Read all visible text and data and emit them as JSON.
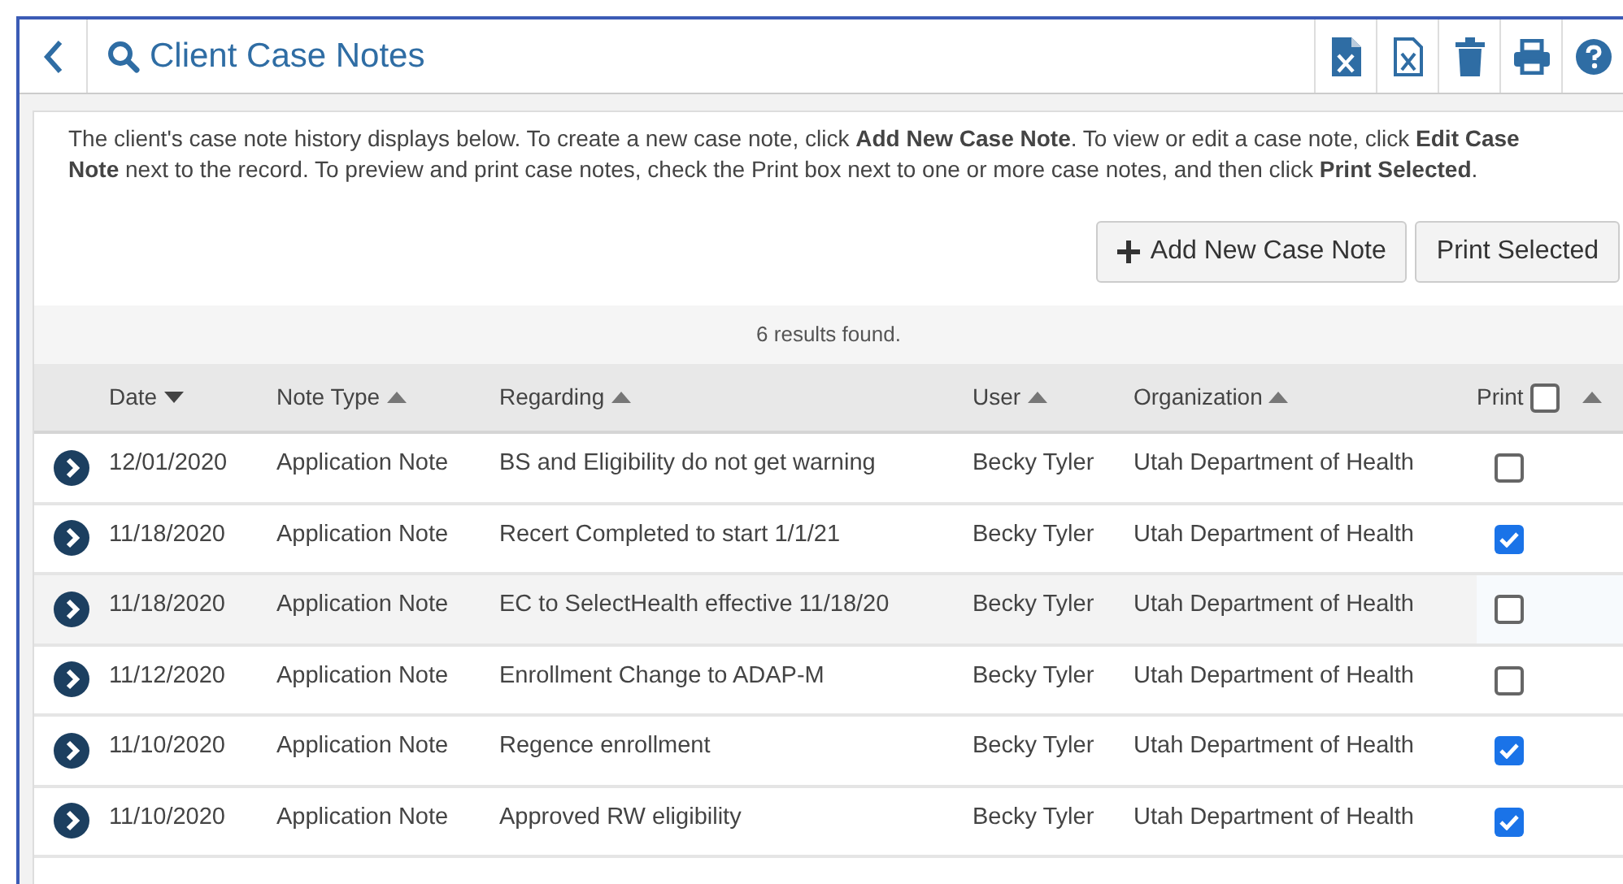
{
  "header": {
    "title": "Client Case Notes"
  },
  "toolbar": [
    {
      "kind": "excel"
    },
    {
      "kind": "excel-outline"
    },
    {
      "kind": "trash"
    },
    {
      "kind": "print"
    },
    {
      "kind": "help"
    }
  ],
  "description": "The client's case note history displays below. To create a new case note, click **Add New Case Note**. To view or edit a case note, click **Edit Case Note** next to the record.  To preview and print case notes, check the Print box next to one or more case notes, and then click **Print Selected**.",
  "buttons": [
    {
      "kind": "add",
      "label": "Add New Case Note"
    },
    {
      "kind": "plain",
      "label": "Print Selected"
    }
  ],
  "results": "6 results found.",
  "table": {
    "columns": [
      {
        "label": "Date",
        "sort_descending": true
      },
      {
        "label": "Note Type",
        "sort_descending": false
      },
      {
        "label": "Regarding",
        "sort_descending": false
      },
      {
        "label": "User",
        "sort_descending": false
      },
      {
        "label": "Organization",
        "sort_descending": false
      },
      {
        "label": "Print",
        "sort_descending": false,
        "select_all": false
      }
    ],
    "rows": [
      {
        "date": "12/01/2020",
        "note_type": "Application Note",
        "regarding": "BS and Eligibility do not get warning",
        "user": "Becky Tyler",
        "organization": "Utah Department of Health",
        "print": false,
        "hovered": false
      },
      {
        "date": "11/18/2020",
        "note_type": "Application Note",
        "regarding": "Recert Completed to start 1/1/21",
        "user": "Becky Tyler",
        "organization": "Utah Department of Health",
        "print": true,
        "hovered": false
      },
      {
        "date": "11/18/2020",
        "note_type": "Application Note",
        "regarding": "EC to SelectHealth effective 11/18/20",
        "user": "Becky Tyler",
        "organization": "Utah Department of Health",
        "print": false,
        "hovered": true
      },
      {
        "date": "11/12/2020",
        "note_type": "Application Note",
        "regarding": "Enrollment Change to ADAP-M",
        "user": "Becky Tyler",
        "organization": "Utah Department of Health",
        "print": false,
        "hovered": false
      },
      {
        "date": "11/10/2020",
        "note_type": "Application Note",
        "regarding": "Regence enrollment",
        "user": "Becky Tyler",
        "organization": "Utah Department of Health",
        "print": true,
        "hovered": false
      },
      {
        "date": "11/10/2020",
        "note_type": "Application Note",
        "regarding": "Approved RW eligibility",
        "user": "Becky Tyler",
        "organization": "Utah Department of Health",
        "print": true,
        "hovered": false
      }
    ]
  }
}
